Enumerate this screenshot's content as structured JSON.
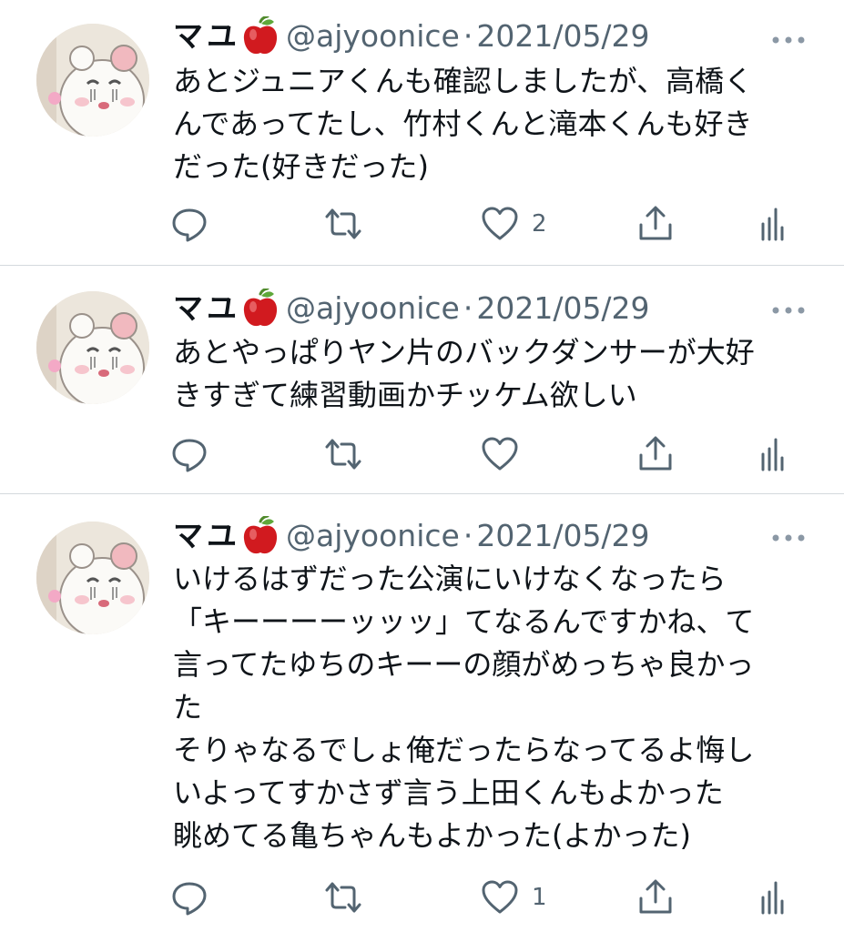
{
  "accent_color": "#536471",
  "tweets": [
    {
      "display_name": "マユ",
      "handle": "@ajyoonice",
      "separator": "·",
      "date": "2021/05/29",
      "lines": [
        "あとジュニアくんも確認しましたが、高橋く",
        "んであってたし、竹村くんと滝本くんも好き",
        "だった(好きだった)"
      ],
      "likes": "2"
    },
    {
      "display_name": "マユ",
      "handle": "@ajyoonice",
      "separator": "·",
      "date": "2021/05/29",
      "lines": [
        "あとやっぱりヤン片のバックダンサーが大好",
        "きすぎて練習動画かチッケム欲しい"
      ],
      "likes": ""
    },
    {
      "display_name": "マユ",
      "handle": "@ajyoonice",
      "separator": "·",
      "date": "2021/05/29",
      "lines": [
        "いけるはずだった公演にいけなくなったら",
        "「キーーーーッッッ」てなるんですかね、て",
        "言ってたゆちのキーーの顔がめっちゃ良かっ",
        "た",
        "そりゃなるでしょ俺だったらなってるよ悔し",
        "いよってすかさず言う上田くんもよかった",
        "眺めてる亀ちゃんもよかった(よかった)"
      ],
      "likes": "1"
    }
  ]
}
